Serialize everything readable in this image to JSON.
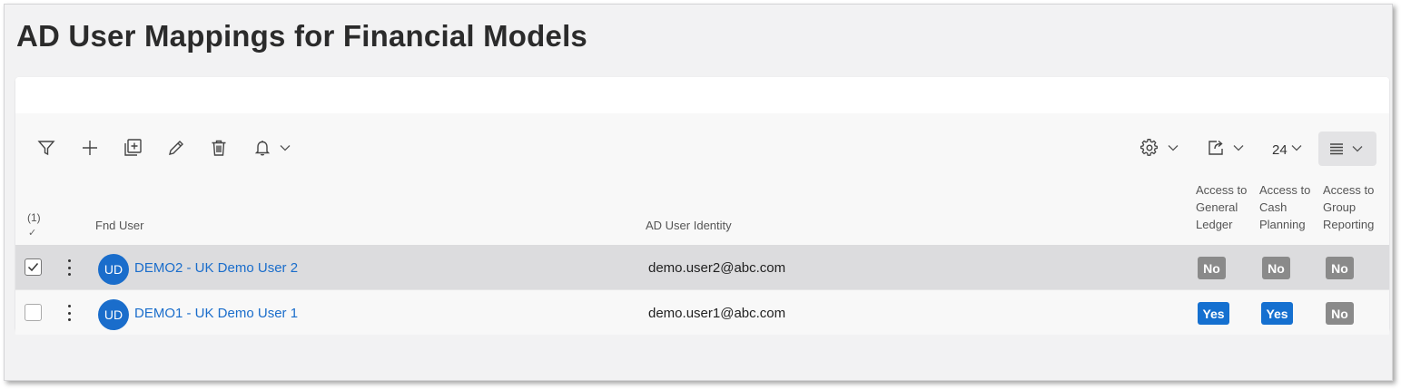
{
  "page": {
    "title": "AD User Mappings for Financial Models"
  },
  "toolbar": {
    "page_size": "24",
    "icons": [
      "filter-icon",
      "add-icon",
      "duplicate-icon",
      "edit-icon",
      "delete-icon",
      "bell-icon",
      "settings-icon",
      "export-icon",
      "list-layout-icon"
    ]
  },
  "grid": {
    "selection_count": "(1)",
    "headers": {
      "fnd_user": "Fnd User",
      "ad_identity": "AD User Identity",
      "gl": [
        "Access to",
        "General",
        "Ledger"
      ],
      "cash": [
        "Access to",
        "Cash",
        "Planning"
      ],
      "group": [
        "Access to",
        "Group",
        "Reporting"
      ]
    },
    "rows": [
      {
        "selected": true,
        "initials": "UD",
        "user": "DEMO2 - UK Demo User 2",
        "identity": "demo.user2@abc.com",
        "gl": "No",
        "cash": "No",
        "group": "No"
      },
      {
        "selected": false,
        "initials": "UD",
        "user": "DEMO1 - UK Demo User 1",
        "identity": "demo.user1@abc.com",
        "gl": "Yes",
        "cash": "Yes",
        "group": "No"
      }
    ]
  },
  "colors": {
    "link": "#1a6dcb",
    "yes_badge": "#1570d0",
    "no_badge": "#8a8a8a",
    "selected_row": "#dcdcde"
  }
}
